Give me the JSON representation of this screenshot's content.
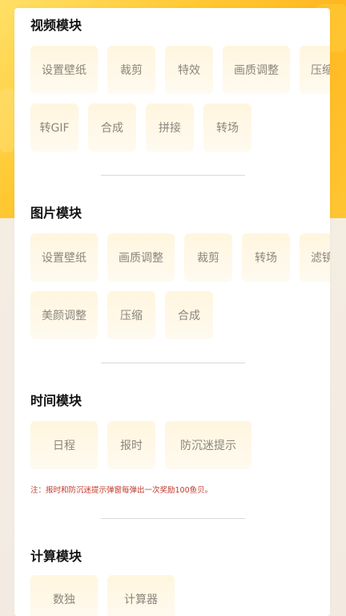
{
  "sections": [
    {
      "title": "视频模块",
      "items": [
        "设置壁纸",
        "裁剪",
        "特效",
        "画质调整",
        "压缩",
        "转GIF",
        "合成",
        "拼接",
        "转场"
      ]
    },
    {
      "title": "图片模块",
      "items": [
        "设置壁纸",
        "画质调整",
        "裁剪",
        "转场",
        "滤镜",
        "美颜调整",
        "压缩",
        "合成"
      ]
    },
    {
      "title": "时间模块",
      "items": [
        "日程",
        "报时",
        "防沉迷提示"
      ],
      "note": "注：报时和防沉迷提示弹窗每弹出一次奖励100鱼贝。"
    },
    {
      "title": "计算模块",
      "items": [
        "数独",
        "计算器"
      ]
    }
  ],
  "colors": {
    "accent": "#ffc933",
    "chip_bg": "#fff6df",
    "chip_text": "#8b847b",
    "note": "#c0392b"
  }
}
